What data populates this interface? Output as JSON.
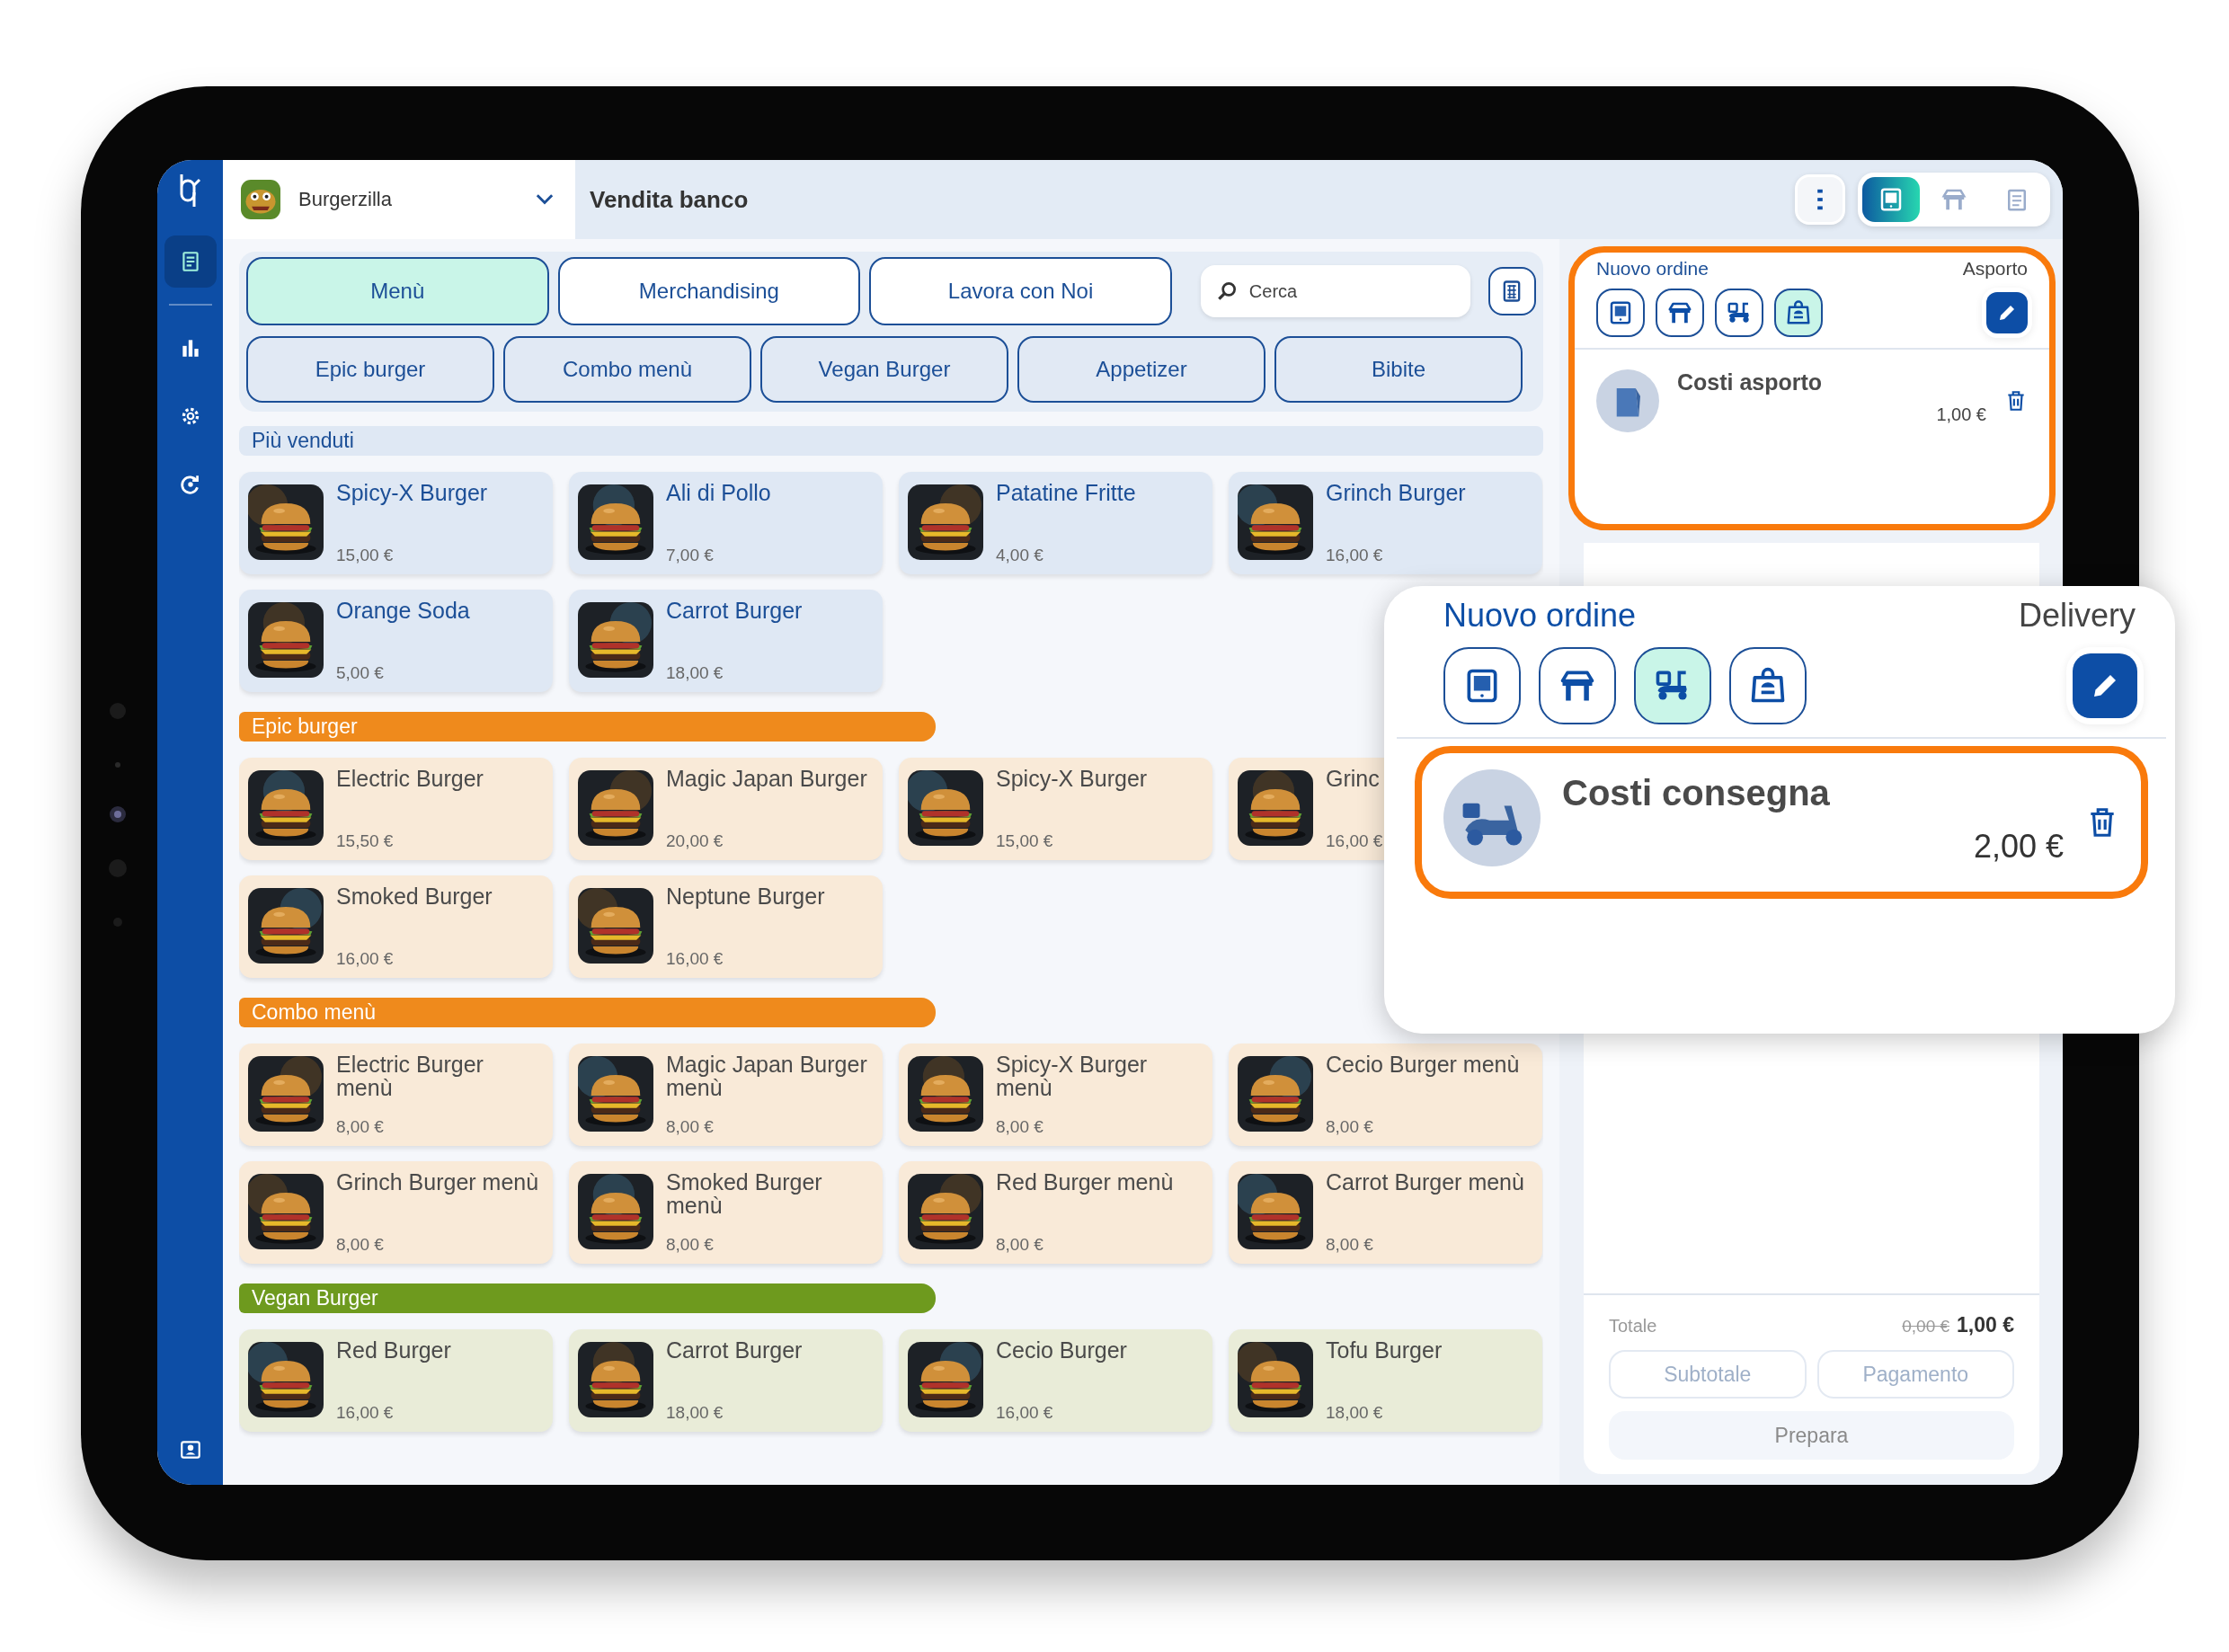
{
  "header": {
    "store": "Burgerzilla",
    "title": "Vendita banco",
    "views": [
      {
        "selected": true
      },
      {
        "selected": false
      },
      {
        "selected": false
      }
    ]
  },
  "sidebar": {
    "items": [
      {
        "selected": true
      },
      {
        "selected": false
      },
      {
        "selected": false
      },
      {
        "selected": false
      }
    ]
  },
  "menus": [
    {
      "label": "Menù",
      "selected": true
    },
    {
      "label": "Merchandising",
      "selected": false
    },
    {
      "label": "Lavora con Noi",
      "selected": false
    }
  ],
  "search": {
    "placeholder": "Cerca"
  },
  "categories": [
    {
      "label": "Epic burger",
      "selected": false
    },
    {
      "label": "Combo menù",
      "selected": false
    },
    {
      "label": "Vegan Burger",
      "selected": false
    },
    {
      "label": "Appetizer",
      "selected": false
    },
    {
      "label": "Bibite",
      "selected": false
    }
  ],
  "sections": [
    {
      "title": "Più venduti",
      "kind": "featured",
      "color": "#dfe8f4",
      "products": [
        {
          "name": "Spicy-X Burger",
          "price": "15,00 €"
        },
        {
          "name": "Ali di Pollo",
          "price": "7,00 €"
        },
        {
          "name": "Patatine Fritte",
          "price": "4,00 €"
        },
        {
          "name": "Grinch Burger",
          "price": "16,00 €"
        },
        {
          "name": "Orange Soda",
          "price": "5,00 €"
        },
        {
          "name": "Carrot Burger",
          "price": "18,00 €"
        }
      ]
    },
    {
      "title": "Epic burger",
      "kind": "category",
      "color": "#ef8a1c",
      "products": [
        {
          "name": "Electric Burger",
          "price": "15,50 €"
        },
        {
          "name": "Magic Japan Burger",
          "price": "20,00 €"
        },
        {
          "name": "Spicy-X Burger",
          "price": "15,00 €"
        },
        {
          "name": "Grinc",
          "price": "16,00 €"
        },
        {
          "name": "Smoked Burger",
          "price": "16,00 €"
        },
        {
          "name": "Neptune Burger",
          "price": "16,00 €"
        }
      ]
    },
    {
      "title": "Combo menù",
      "kind": "category",
      "color": "#ef8a1c",
      "products": [
        {
          "name": "Electric Burger menù",
          "price": "8,00 €"
        },
        {
          "name": "Magic Japan Burger menù",
          "price": "8,00 €"
        },
        {
          "name": "Spicy-X Burger menù",
          "price": "8,00 €"
        },
        {
          "name": "Cecio Burger menù",
          "price": "8,00 €"
        },
        {
          "name": "Grinch Burger menù",
          "price": "8,00 €"
        },
        {
          "name": "Smoked Burger menù",
          "price": "8,00 €"
        },
        {
          "name": "Red Burger menù",
          "price": "8,00 €"
        },
        {
          "name": "Carrot Burger menù",
          "price": "8,00 €"
        }
      ]
    },
    {
      "title": "Vegan Burger",
      "kind": "category",
      "color": "#6e9a1e",
      "products": [
        {
          "name": "Red Burger",
          "price": "16,00 €"
        },
        {
          "name": "Carrot Burger",
          "price": "18,00 €"
        },
        {
          "name": "Cecio Burger",
          "price": "16,00 €"
        },
        {
          "name": "Tofu Burger",
          "price": "18,00 €"
        }
      ]
    }
  ],
  "order": {
    "title": "Nuovo ordine",
    "mode": "Asporto",
    "highlighted": true,
    "types": [
      {
        "selected": false
      },
      {
        "selected": false
      },
      {
        "selected": false
      },
      {
        "selected": true
      }
    ],
    "items": [
      {
        "name": "Costi asporto",
        "price": "1,00 €"
      }
    ],
    "total_label": "Totale",
    "old_total": "0,00 €",
    "total": "1,00 €",
    "actions": [
      {
        "label": "Subtotale",
        "disabled": true
      },
      {
        "label": "Pagamento",
        "disabled": true
      }
    ],
    "prepare": {
      "label": "Prepara",
      "disabled": true
    }
  },
  "callout": {
    "title": "Nuovo ordine",
    "mode": "Delivery",
    "types": [
      {
        "selected": false
      },
      {
        "selected": false
      },
      {
        "selected": true
      },
      {
        "selected": false
      }
    ],
    "items": [
      {
        "name": "Costi consegna",
        "price": "2,00 €",
        "highlighted": true
      }
    ]
  }
}
